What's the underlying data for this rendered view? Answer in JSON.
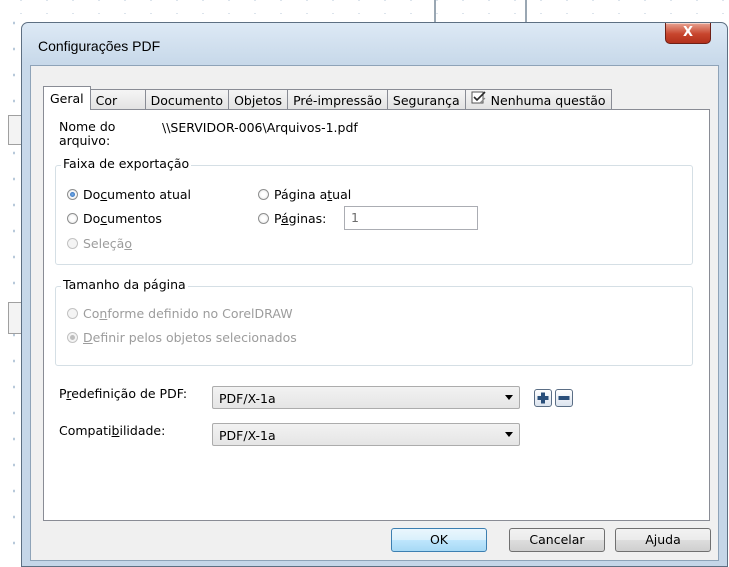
{
  "dialog": {
    "title": "Configurações PDF",
    "close_label": "X"
  },
  "tabs": [
    {
      "label": "Geral",
      "active": true
    },
    {
      "label": "Cor"
    },
    {
      "label": "Documento"
    },
    {
      "label": "Objetos"
    },
    {
      "label": "Pré-impressão"
    },
    {
      "label": "Segurança"
    },
    {
      "label": "Nenhuma questão",
      "icon": "preflight-check-icon"
    }
  ],
  "general": {
    "filename_label_1": "Nome do",
    "filename_label_2": "arquivo:",
    "filename_value": "\\\\SERVIDOR-006\\Arquivos-1.pdf",
    "export_range": {
      "title": "Faixa de exportação",
      "current_document": {
        "pre": "Do",
        "u": "c",
        "post": "umento atual",
        "checked": true
      },
      "documents": {
        "pre": "Do",
        "u": "c",
        "post": "umentos",
        "checked": false
      },
      "selection": {
        "pre": "Seleçã",
        "u": "o",
        "post": "",
        "disabled": true
      },
      "current_page": {
        "pre": "Página a",
        "u": "t",
        "post": "ual",
        "checked": false
      },
      "pages": {
        "pre": "P",
        "u": "á",
        "post": "ginas:",
        "checked": false
      },
      "pages_value": "1"
    },
    "page_size": {
      "title": "Tamanho da página",
      "as_defined": {
        "pre": "Co",
        "u": "n",
        "post": "forme definido no CorelDRAW",
        "disabled": true
      },
      "from_selection": {
        "pre": "",
        "u": "D",
        "post": "efinir pelos objetos selecionados",
        "disabled": true,
        "checked": true
      }
    },
    "preset": {
      "pre": "P",
      "u": "r",
      "post": "edefinição de PDF:",
      "value": "PDF/X-1a"
    },
    "compatibility": {
      "pre": "Compati",
      "u": "b",
      "post": "ilidade:",
      "value": "PDF/X-1a"
    }
  },
  "buttons": {
    "ok": "OK",
    "cancel": "Cancelar",
    "help": "Ajuda"
  },
  "colors": {
    "selected_radio": "#1d5fb5",
    "close_button": "#c7452d",
    "window_frame": "#c8d9ea"
  }
}
